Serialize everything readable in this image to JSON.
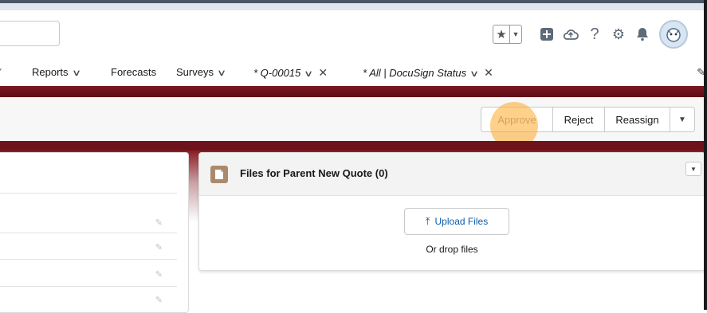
{
  "header": {
    "icons": [
      "star-icon",
      "chevron-down-icon",
      "plus-square-icon",
      "cloud-icon",
      "help-icon",
      "gear-icon",
      "bell-icon",
      "avatar"
    ]
  },
  "nav": {
    "items": [
      {
        "label": "Reports",
        "has_chevron": true
      },
      {
        "label": "Forecasts",
        "has_chevron": false
      },
      {
        "label": "Surveys",
        "has_chevron": true
      },
      {
        "label": "* Q-00015",
        "has_chevron": true,
        "closable": true
      },
      {
        "label": "* All | DocuSign Status",
        "has_chevron": true,
        "closable": true
      }
    ]
  },
  "actions": {
    "approve": "Approve",
    "reject": "Reject",
    "reassign": "Reassign"
  },
  "files": {
    "title": "Files for Parent New Quote (0)",
    "upload_label": "Upload Files",
    "drop_text": "Or drop files"
  }
}
